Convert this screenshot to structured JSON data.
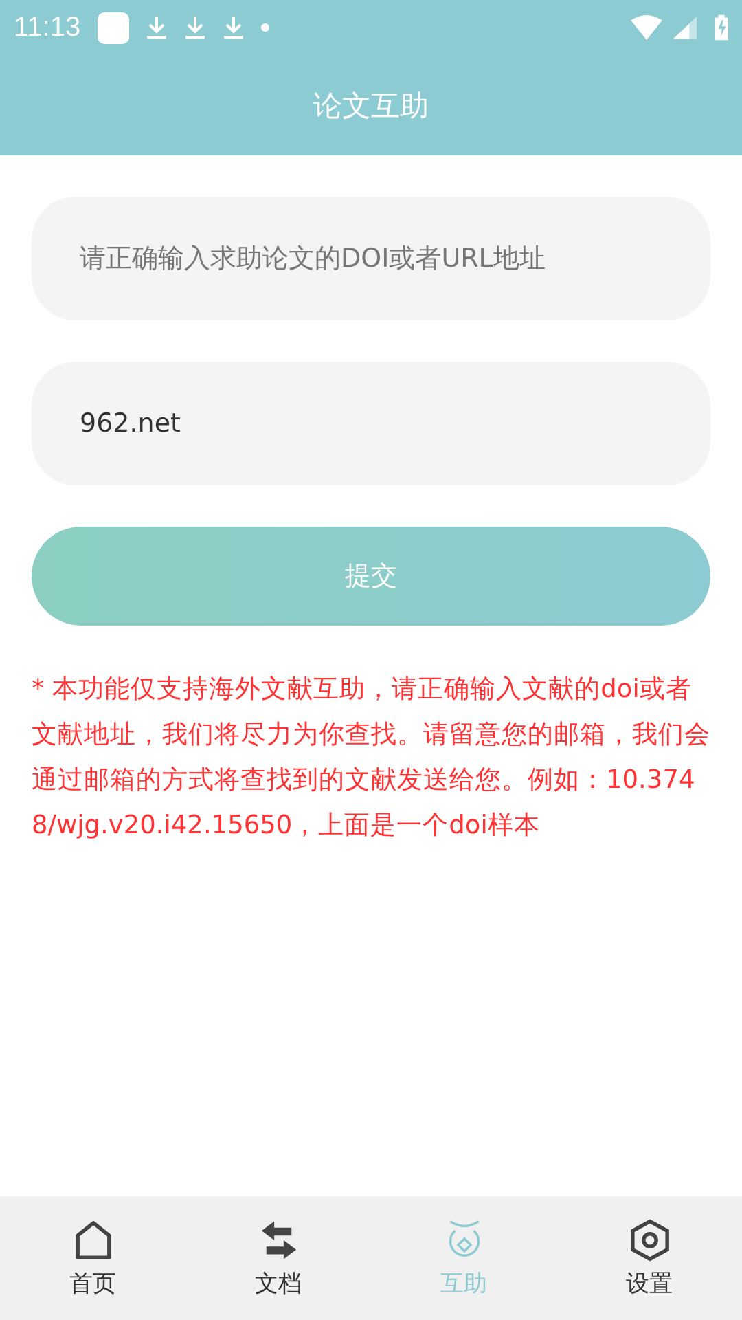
{
  "status_bar": {
    "time": "11:13"
  },
  "header": {
    "title": "论文互助"
  },
  "form": {
    "doi_field": {
      "placeholder": "请正确输入求助论文的DOI或者URL地址"
    },
    "email_field": {
      "value": "962.net"
    },
    "submit": "提交"
  },
  "note": "* 本功能仅支持海外文献互助，请正确输入文献的doi或者文献地址，我们将尽力为你查找。请留意您的邮箱，我们会通过邮箱的方式将查找到的文献发送给您。例如：10.3748/wjg.v20.i42.15650，上面是一个doi样本",
  "tabs": [
    {
      "kind": "home",
      "label": "首页",
      "selected": false
    },
    {
      "kind": "swap",
      "label": "文档",
      "selected": false
    },
    {
      "kind": "coin",
      "label": "互助",
      "selected": true
    },
    {
      "kind": "hex",
      "label": "设置",
      "selected": false
    }
  ]
}
